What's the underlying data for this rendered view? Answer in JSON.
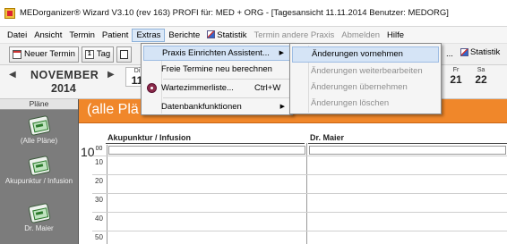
{
  "window": {
    "title": "MEDorganizer® Wizard V3.10 (rev 163) PROFI für: MED + ORG - [Tagesansicht 11.11.2014   Benutzer: MEDORG]"
  },
  "menubar": {
    "items": [
      "Datei",
      "Ansicht",
      "Termin",
      "Patient",
      "Extras",
      "Berichte",
      "Statistik",
      "Termin andere Praxis",
      "Abmelden",
      "Hilfe"
    ]
  },
  "toolbar": {
    "new_appointment": "Neuer Termin",
    "day_icon_num": "1",
    "day_label": "Tag",
    "dots": "...",
    "statistik": "Statistik"
  },
  "datestrip": {
    "nav_left": "◀",
    "month": "NOVEMBER",
    "year": "2014",
    "nav_right": "▶",
    "days": [
      {
        "name": "Di",
        "num": "11"
      },
      {
        "name": "Fr",
        "num": "21"
      },
      {
        "name": "Sa",
        "num": "22"
      }
    ]
  },
  "sidebar": {
    "header": "Pläne",
    "items": [
      "(Alle Pläne)",
      "Akupunktur / Infusion",
      "Dr. Maier"
    ]
  },
  "plan_header": {
    "text": "(alle Plä"
  },
  "grid": {
    "columns": [
      "Akupunktur / Infusion",
      "Dr. Maier"
    ],
    "hour": "10",
    "hour_sup": "00",
    "slots": [
      "10",
      "20",
      "30",
      "40",
      "50"
    ]
  },
  "extras_menu": {
    "items": [
      {
        "label": "Praxis Einrichten Assistent...",
        "shortcut": "",
        "submenu": true
      },
      {
        "label": "Freie Termine neu berechnen",
        "shortcut": "",
        "submenu": false
      },
      {
        "label": "Wartezimmerliste...",
        "shortcut": "Ctrl+W",
        "submenu": false
      },
      {
        "label": "Datenbankfunktionen",
        "shortcut": "",
        "submenu": true
      }
    ]
  },
  "submenu": {
    "items": [
      "Änderungen vornehmen",
      "Änderungen weiterbearbeiten",
      "Änderungen übernehmen",
      "Änderungen löschen"
    ]
  }
}
